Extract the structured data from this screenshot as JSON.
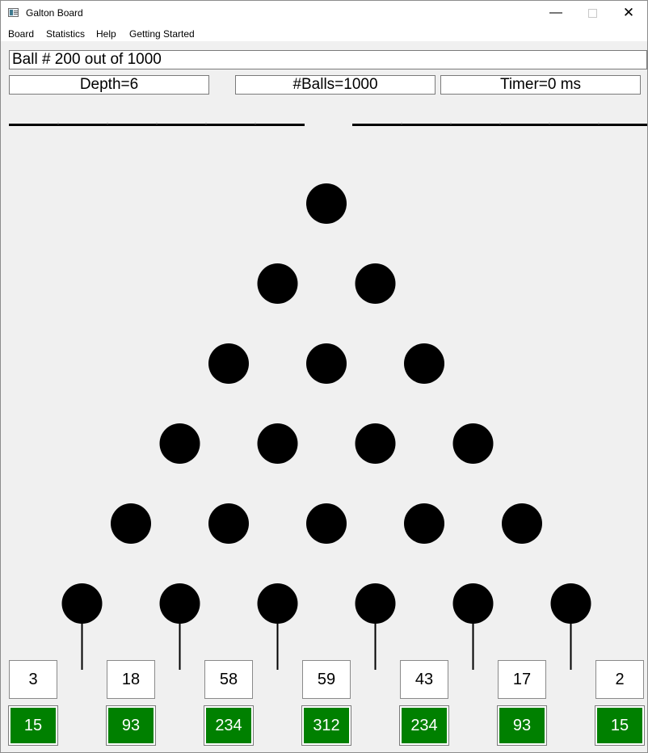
{
  "window": {
    "title": "Galton Board"
  },
  "menu": [
    {
      "label": "Board"
    },
    {
      "label": "Statistics"
    },
    {
      "label": "Help"
    },
    {
      "label": "Getting Started"
    }
  ],
  "status": {
    "text": "Ball # 200 out of 1000"
  },
  "info": {
    "depth": "Depth=6",
    "balls": "#Balls=1000",
    "timer": "Timer=0 ms"
  },
  "board": {
    "depth": 6,
    "peg_color": "#000000"
  },
  "bins": {
    "counts": [
      "3",
      "18",
      "58",
      "59",
      "43",
      "17",
      "2"
    ],
    "expected": [
      "15",
      "93",
      "234",
      "312",
      "234",
      "93",
      "15"
    ],
    "expected_color": "#008000"
  }
}
